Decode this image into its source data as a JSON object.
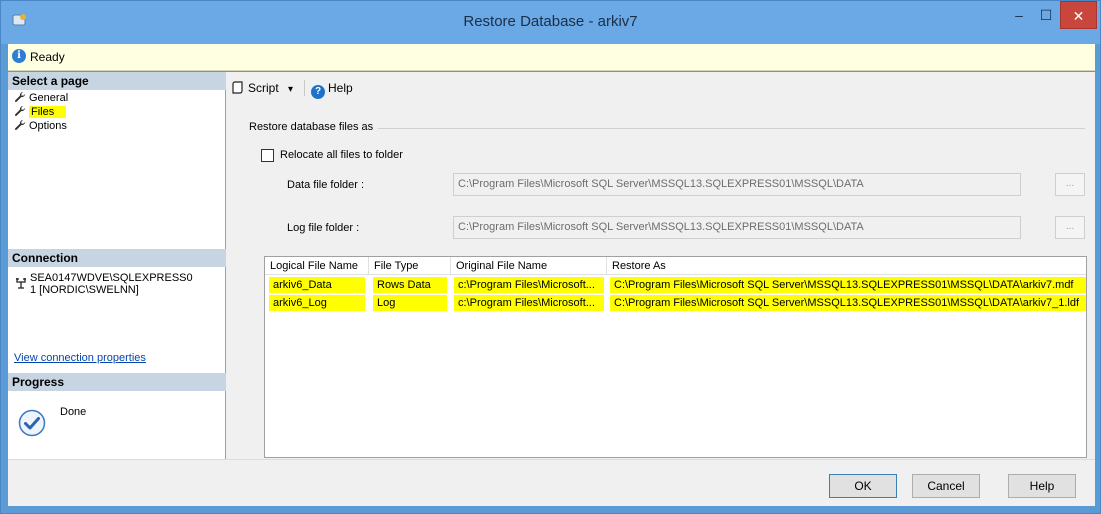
{
  "window": {
    "title": "Restore Database - arkiv7",
    "minimize_glyph": "–",
    "maximize_glyph": "☐",
    "close_glyph": "✕"
  },
  "status": {
    "icon": "info-icon",
    "text": "Ready"
  },
  "left_pane": {
    "select_page_header": "Select a page",
    "pages": [
      {
        "label": "General",
        "icon": "wrench-icon",
        "highlighted": false
      },
      {
        "label": "Files",
        "icon": "wrench-icon",
        "highlighted": true
      },
      {
        "label": "Options",
        "icon": "wrench-icon",
        "highlighted": false
      }
    ],
    "connection_header": "Connection",
    "connection_line1": "SEA0147WDVE\\SQLEXPRESS0",
    "connection_line2": "1 [NORDIC\\SWELNN]",
    "connection_link": "View connection properties",
    "progress_header": "Progress",
    "progress_status": "Done"
  },
  "toolbar": {
    "script_label": "Script",
    "script_dropdown_glyph": "▾",
    "help_label": "Help"
  },
  "restore_files": {
    "group_title": "Restore database files as",
    "relocate_label": "Relocate all files to folder",
    "relocate_checked": false,
    "data_folder_label": "Data file folder :",
    "data_folder_value": "C:\\Program Files\\Microsoft SQL Server\\MSSQL13.SQLEXPRESS01\\MSSQL\\DATA",
    "log_folder_label": "Log file folder :",
    "log_folder_value": "C:\\Program Files\\Microsoft SQL Server\\MSSQL13.SQLEXPRESS01\\MSSQL\\DATA",
    "browse_label": "..."
  },
  "grid": {
    "columns": [
      "Logical File Name",
      "File Type",
      "Original File Name",
      "Restore As"
    ],
    "rows": [
      [
        "arkiv6_Data",
        "Rows Data",
        "c:\\Program Files\\Microsoft...",
        "C:\\Program Files\\Microsoft SQL Server\\MSSQL13.SQLEXPRESS01\\MSSQL\\DATA\\arkiv7.mdf"
      ],
      [
        "arkiv6_Log",
        "Log",
        "c:\\Program Files\\Microsoft...",
        "C:\\Program Files\\Microsoft SQL Server\\MSSQL13.SQLEXPRESS01\\MSSQL\\DATA\\arkiv7_1.ldf"
      ]
    ],
    "highlight_color": "#ffff00"
  },
  "buttons": {
    "ok": "OK",
    "cancel": "Cancel",
    "help": "Help"
  },
  "colors": {
    "titlebar": "#6aa8e6",
    "close_button": "#c9463d",
    "status_bg": "#ffffe1",
    "section_header": "#c7d4e2"
  }
}
